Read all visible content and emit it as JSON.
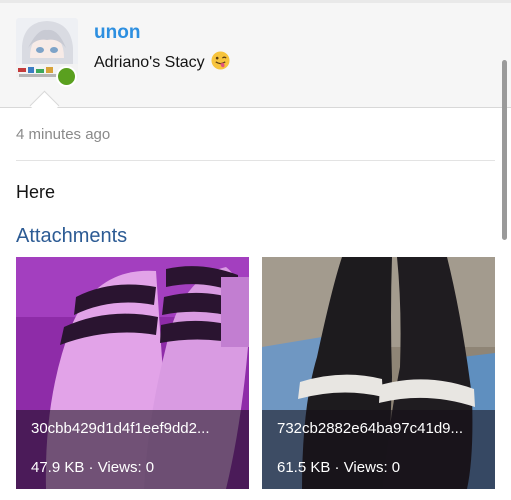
{
  "post": {
    "username": "unon",
    "user_title": "Adriano's Stacy",
    "timestamp": "4 minutes ago",
    "message": "Here"
  },
  "attachments_section": {
    "heading": "Attachments",
    "items": [
      {
        "filename": "30cbb429d1d4f1eef9dd2...",
        "size": "47.9 KB",
        "views_label": "Views: 0",
        "meta": "47.9 KB · Views: 0"
      },
      {
        "filename": "732cb2882e64ba97c41d9...",
        "size": "61.5 KB",
        "views_label": "Views: 0",
        "meta": "61.5 KB · Views: 0"
      }
    ]
  },
  "icons": {
    "avatar": "avatar-image",
    "status": "online-status-dot",
    "title_emoji": "tongue-wink-emoji-icon"
  },
  "colors": {
    "username": "#2d8fe0",
    "heading": "#2c5b94",
    "online": "#5aa01f",
    "header_bg": "#f6f6f6"
  }
}
